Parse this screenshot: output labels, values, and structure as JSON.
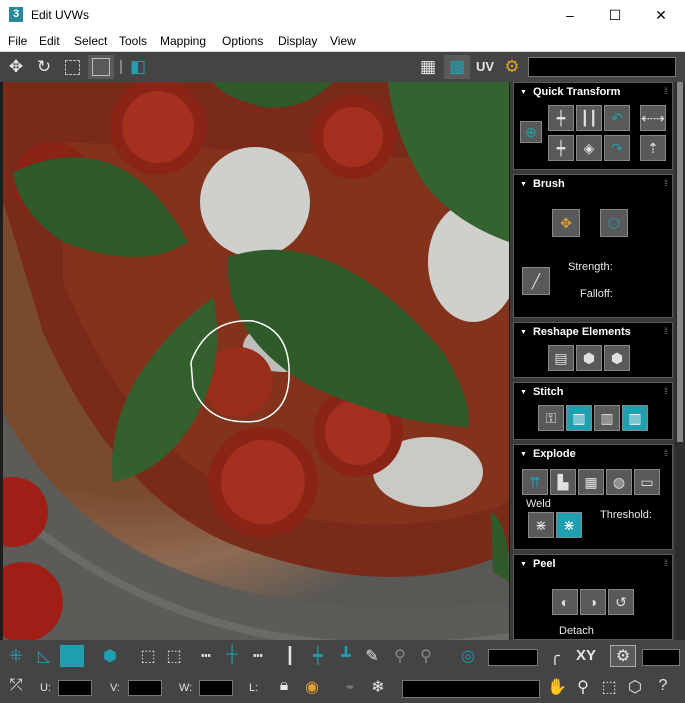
{
  "window": {
    "title": "Edit UVWs",
    "app_icon": "3",
    "minimize": "–",
    "maximize": "☐",
    "close": "✕"
  },
  "menu": [
    "File",
    "Edit",
    "Select",
    "Tools",
    "Mapping",
    "Options",
    "Display",
    "View"
  ],
  "toolbar": {
    "uv_label": "UV"
  },
  "panels": {
    "quick_transform": "Quick Transform",
    "brush": "Brush",
    "strength": "Strength:",
    "falloff": "Falloff:",
    "reshape": "Reshape Elements",
    "stitch": "Stitch",
    "explode": "Explode",
    "weld": "Weld",
    "threshold": "Threshold:",
    "peel": "Peel",
    "detach": "Detach"
  },
  "bottom": {
    "xy": "XY",
    "u": "U:",
    "v": "V:",
    "w": "W:",
    "l": "L:"
  },
  "colors": {
    "accent": "#1f9fb0",
    "toolbar_bg": "#444444",
    "panel_bg": "#000000"
  }
}
